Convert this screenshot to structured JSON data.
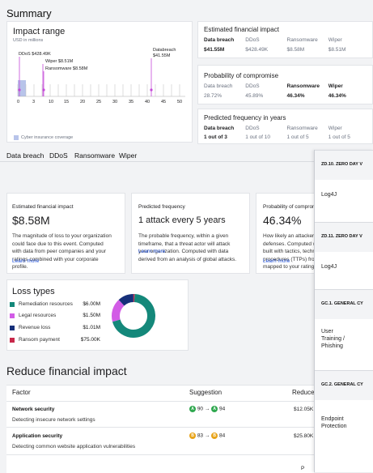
{
  "summary_title": "Summary",
  "impact_range": {
    "title": "Impact range",
    "unit": "USD in millions",
    "ddos_label": "DDoS $428.49K",
    "wiper_label": "Wiper $8.51M",
    "ransomware_label": "Ransomware $8.58M",
    "databreach_label": "Databreach",
    "databreach_value": "$41.55M",
    "ticks": [
      "0",
      "3",
      "10",
      "15",
      "20",
      "25",
      "30",
      "35",
      "40",
      "45",
      "50"
    ],
    "cyber_insurance": "Cyber insurance coverage"
  },
  "estimated_impact": {
    "title": "Estimated financial impact",
    "headers": [
      "Data breach",
      "DDoS",
      "Ransomware",
      "Wiper"
    ],
    "values": [
      "$41.55M",
      "$428.49K",
      "$8.58M",
      "$8.51M"
    ]
  },
  "probability": {
    "title": "Probability of compromise",
    "headers": [
      "Data breach",
      "DDoS",
      "Ransomware",
      "Wiper"
    ],
    "values": [
      "28.72%",
      "45.89%",
      "46.34%",
      "46.34%"
    ]
  },
  "frequency": {
    "title": "Predicted frequency in years",
    "headers": [
      "Data breach",
      "DDoS",
      "Ransomware",
      "Wiper"
    ],
    "values": [
      "1 out of 3",
      "1 out of 10",
      "1 out of 5",
      "1 out of 5"
    ]
  },
  "tabs": [
    "Data breach",
    "DDoS",
    "Ransomware",
    "Wiper"
  ],
  "active_tab": "Ransomware",
  "detail_cards": {
    "impact": {
      "title": "Estimated financial impact",
      "value": "$8.58M",
      "desc": [
        "The magnitude of loss to your organization",
        "could face due to this event. Computed",
        "with data from peer companies and your",
        "ratings combined with your corporate",
        "profile."
      ],
      "link": "Learn more"
    },
    "frequency": {
      "title": "Predicted frequency",
      "value": "1 attack every 5 years",
      "desc": [
        "The probable frequency, within a given",
        "timeframe, that a threat actor will attack",
        "your organization. Computed with data",
        "derived from an analysis of global attacks."
      ],
      "link": "Learn more"
    },
    "probability": {
      "title": "Probability of compron",
      "value": "46.34%",
      "desc": [
        "How likely an attacker",
        "defenses. Computed w",
        "built with tactics, techn",
        "procedures (TTPs) fron",
        "mapped to your ratings"
      ],
      "link": "Learn more"
    }
  },
  "loss_types": {
    "title": "Loss types",
    "items": [
      {
        "label": "Remediation resources",
        "value": "$6.00M",
        "color": "#14887a"
      },
      {
        "label": "Legal resources",
        "value": "$1.50M",
        "color": "#d25ce6"
      },
      {
        "label": "Revenue loss",
        "value": "$1.01M",
        "color": "#16307a"
      },
      {
        "label": "Ransom payment",
        "value": "$75.00K",
        "color": "#c8284a"
      }
    ]
  },
  "chart_data": {
    "type": "pie",
    "title": "Loss types",
    "categories": [
      "Remediation resources",
      "Legal resources",
      "Revenue loss",
      "Ransom payment"
    ],
    "values": [
      6.0,
      1.5,
      1.01,
      0.075
    ],
    "unit": "USD millions"
  },
  "reduce": {
    "title": "Reduce financial impact",
    "col_factor": "Factor",
    "col_suggestion": "Suggestion",
    "col_reduce": "Reduce",
    "rows": [
      {
        "title": "Network security",
        "desc": "Detecting insecure network settings",
        "from": "90",
        "to": "94",
        "from_color": "#2fa84f",
        "to_color": "#2fa84f",
        "reduce": "$12.05K"
      },
      {
        "title": "Application security",
        "desc": "Detecting common website application vulnerabilities",
        "from": "83",
        "to": "84",
        "from_color": "#e8a317",
        "to_color": "#e8a317",
        "reduce": "$25.80K"
      }
    ],
    "footer_fragment": "P"
  },
  "side_panel": {
    "sections": [
      {
        "header": "ZD.10. ZERO DAY V",
        "body": "Log4J"
      },
      {
        "header": "ZD.11. ZERO DAY V",
        "body": "Log4J"
      },
      {
        "header": "GC.1. GENERAL CY",
        "body": "User Training / Phishing"
      },
      {
        "header": "GC.2. GENERAL CY",
        "body": "Endpoint Protection"
      }
    ]
  }
}
